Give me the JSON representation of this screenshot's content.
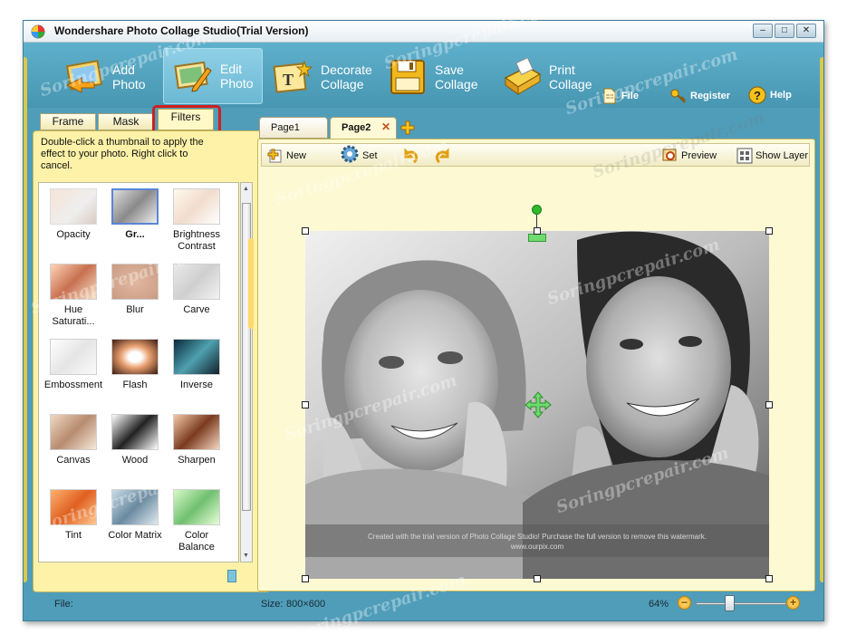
{
  "window": {
    "title": "Wondershare Photo Collage Studio(Trial Version)",
    "controls": [
      "‒",
      "□",
      "✕"
    ]
  },
  "ribbon": {
    "tools": [
      {
        "id": "add-photo",
        "label": [
          "Add",
          "Photo"
        ],
        "icon": "add-photo-icon"
      },
      {
        "id": "edit-photo",
        "label": [
          "Edit",
          "Photo"
        ],
        "icon": "edit-photo-icon",
        "active": true
      },
      {
        "id": "decorate-collage",
        "label": [
          "Decorate",
          "Collage"
        ],
        "icon": "decorate-icon"
      },
      {
        "id": "save-collage",
        "label": [
          "Save",
          "Collage"
        ],
        "icon": "floppy-disk-icon"
      },
      {
        "id": "print-collage",
        "label": [
          "Print",
          "Collage"
        ],
        "icon": "printer-icon"
      }
    ],
    "menu": [
      {
        "id": "file",
        "label": "File",
        "icon": "file-icon"
      },
      {
        "id": "register",
        "label": "Register",
        "icon": "key-icon"
      },
      {
        "id": "help",
        "label": "Help",
        "icon": "help-icon"
      }
    ]
  },
  "left_panel": {
    "tabs": [
      "Frame",
      "Mask",
      "Filters"
    ],
    "selected_tab": "Filters",
    "hint": "Double-click a thumbnail to apply the effect to your photo. Right click to cancel.",
    "filters": [
      [
        "Opacity"
      ],
      [
        "Gr..."
      ],
      [
        "Brightness",
        "Contrast"
      ],
      [
        "Hue",
        "Saturati..."
      ],
      [
        "Blur"
      ],
      [
        "Carve"
      ],
      [
        "Embossment"
      ],
      [
        "Flash"
      ],
      [
        "Inverse"
      ],
      [
        "Canvas"
      ],
      [
        "Wood"
      ],
      [
        "Sharpen"
      ],
      [
        "Tint"
      ],
      [
        "Color Matrix"
      ],
      [
        "Color",
        "Balance"
      ]
    ],
    "selected_filter": "Gr..."
  },
  "pages": {
    "tabs": [
      "Page1",
      "Page2"
    ],
    "selected": "Page2"
  },
  "editor_toolbar": {
    "new": "New",
    "set": "Set",
    "preview": "Preview",
    "show_layer": "Show Layer"
  },
  "photo": {
    "watermark_line1": "Created with the trial version of Photo Collage Studio!  Purchase the full version to remove this watermark.",
    "watermark_line2": "www.ourpix.com"
  },
  "status": {
    "file_label": "File:",
    "size_label": "Size:",
    "size_value": "800×600",
    "zoom": "64%",
    "zoom_level": 0.38
  },
  "site_watermark": "Soringpcrepair.com",
  "colors": {
    "frame": "#4f9db9",
    "panel": "#fdf2a8",
    "highlight": "#d01f1f",
    "canvas": "#fdf9d3"
  }
}
